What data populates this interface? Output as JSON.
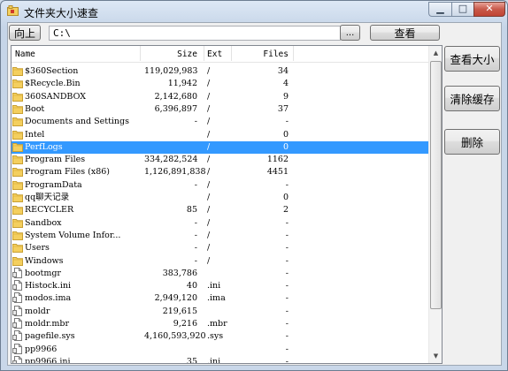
{
  "window": {
    "title": "文件夹大小速查",
    "min_glyph": "▁",
    "max_glyph": "□",
    "close_glyph": "✕"
  },
  "toolbar": {
    "up_label": "向上",
    "path_value": "C:\\",
    "browse_label": "...",
    "view_label": "查看"
  },
  "side_buttons": {
    "view_size_label": "查看大小",
    "clear_cache_label": "清除缓存",
    "delete_label": "删除"
  },
  "list": {
    "columns": [
      "Name",
      "Size",
      "Ext",
      "Files"
    ],
    "rows": [
      {
        "type": "folder",
        "name": "$360Section",
        "size": "119,029,983",
        "ext": "/",
        "files": "34"
      },
      {
        "type": "folder",
        "name": "$Recycle.Bin",
        "size": "11,942",
        "ext": "/",
        "files": "4"
      },
      {
        "type": "folder",
        "name": "360SANDBOX",
        "size": "2,142,680",
        "ext": "/",
        "files": "9"
      },
      {
        "type": "folder",
        "name": "Boot",
        "size": "6,396,897",
        "ext": "/",
        "files": "37"
      },
      {
        "type": "folder",
        "name": "Documents and Settings",
        "size": "-",
        "ext": "/",
        "files": "-"
      },
      {
        "type": "folder",
        "name": "Intel",
        "size": "",
        "ext": "/",
        "files": "0"
      },
      {
        "type": "folder",
        "name": "PerfLogs",
        "size": "",
        "ext": "/",
        "files": "0",
        "selected": true
      },
      {
        "type": "folder",
        "name": "Program Files",
        "size": "334,282,524",
        "ext": "/",
        "files": "1162"
      },
      {
        "type": "folder",
        "name": "Program Files (x86)",
        "size": "1,126,891,838",
        "ext": "/",
        "files": "4451"
      },
      {
        "type": "folder",
        "name": "ProgramData",
        "size": "-",
        "ext": "/",
        "files": "-"
      },
      {
        "type": "folder",
        "name": "qq聊天记录",
        "size": "",
        "ext": "/",
        "files": "0"
      },
      {
        "type": "folder",
        "name": "RECYCLER",
        "size": "85",
        "ext": "/",
        "files": "2"
      },
      {
        "type": "folder",
        "name": "Sandbox",
        "size": "-",
        "ext": "/",
        "files": "-"
      },
      {
        "type": "folder",
        "name": "System Volume Infor...",
        "size": "-",
        "ext": "/",
        "files": "-"
      },
      {
        "type": "folder",
        "name": "Users",
        "size": "-",
        "ext": "/",
        "files": "-"
      },
      {
        "type": "folder",
        "name": "Windows",
        "size": "-",
        "ext": "/",
        "files": "-"
      },
      {
        "type": "file",
        "name": "bootmgr",
        "size": "383,786",
        "ext": "",
        "files": "-"
      },
      {
        "type": "file",
        "name": "Histock.ini",
        "size": "40",
        "ext": ".ini",
        "files": "-"
      },
      {
        "type": "file",
        "name": "modos.ima",
        "size": "2,949,120",
        "ext": ".ima",
        "files": "-"
      },
      {
        "type": "file",
        "name": "moldr",
        "size": "219,615",
        "ext": "",
        "files": "-"
      },
      {
        "type": "file",
        "name": "moldr.mbr",
        "size": "9,216",
        "ext": ".mbr",
        "files": "-"
      },
      {
        "type": "file",
        "name": "pagefile.sys",
        "size": "4,160,593,920",
        "ext": ".sys",
        "files": "-"
      },
      {
        "type": "file",
        "name": "pp9966",
        "size": "",
        "ext": "",
        "files": "-"
      },
      {
        "type": "file",
        "name": "pp9966.ini",
        "size": "35",
        "ext": ".ini",
        "files": "-"
      }
    ]
  },
  "scrollbar": {
    "up_glyph": "▲",
    "down_glyph": "▼"
  },
  "icons": {
    "folder": "folder-icon",
    "file": "file-icon",
    "app": "app-icon"
  },
  "colors": {
    "selection": "#3399ff",
    "folder": "#f4cf5e",
    "folder_border": "#c9a032"
  }
}
